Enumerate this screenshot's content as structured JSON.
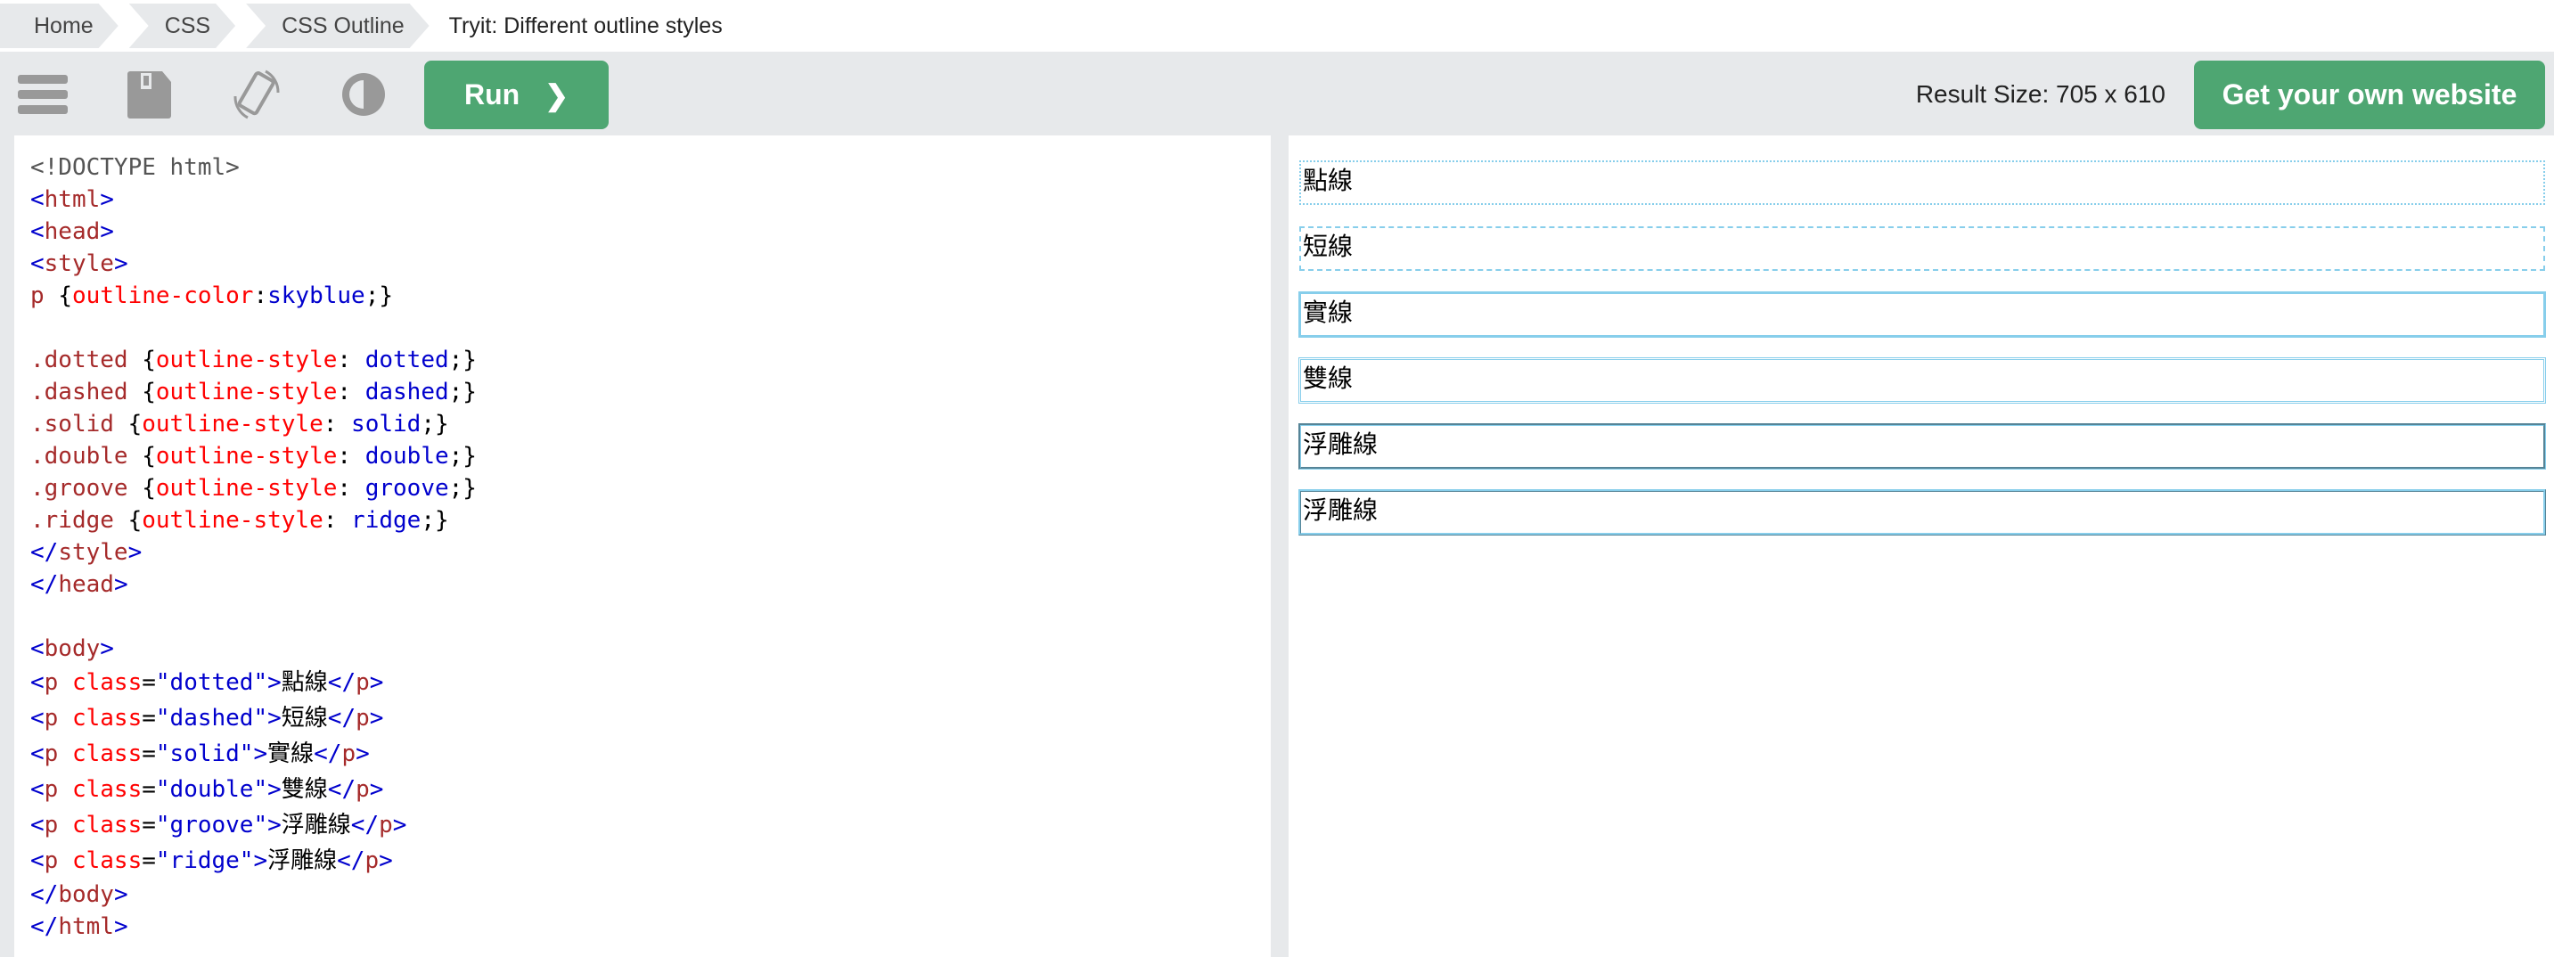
{
  "breadcrumb": [
    "Home",
    "CSS",
    "CSS Outline",
    "Tryit: Different outline styles"
  ],
  "toolbar": {
    "menu_icon": "hamburger-icon",
    "save_icon": "floppy-icon",
    "rotate_icon": "rotate-icon",
    "contrast_icon": "contrast-icon",
    "run_label": "Run",
    "run_chevron": "❯",
    "result_size": "Result Size: 705 x 610",
    "own_website": "Get your own website",
    "accent": "#4ea672"
  },
  "code": [
    [
      [
        "<!DOCTYPE html>",
        "doc"
      ]
    ],
    [
      [
        "<",
        "br"
      ],
      [
        "html",
        "tag"
      ],
      [
        ">",
        "br"
      ]
    ],
    [
      [
        "<",
        "br"
      ],
      [
        "head",
        "tag"
      ],
      [
        ">",
        "br"
      ]
    ],
    [
      [
        "<",
        "br"
      ],
      [
        "style",
        "tag"
      ],
      [
        ">",
        "br"
      ]
    ],
    [
      [
        "p ",
        "sel"
      ],
      [
        "{",
        "txt"
      ],
      [
        "outline-color",
        "prop"
      ],
      [
        ":",
        "txt"
      ],
      [
        "skyblue",
        "val"
      ],
      [
        ";}",
        "txt"
      ]
    ],
    [],
    [
      [
        ".dotted ",
        "sel"
      ],
      [
        "{",
        "txt"
      ],
      [
        "outline-style",
        "prop"
      ],
      [
        ": ",
        "txt"
      ],
      [
        "dotted",
        "val"
      ],
      [
        ";}",
        "txt"
      ]
    ],
    [
      [
        ".dashed ",
        "sel"
      ],
      [
        "{",
        "txt"
      ],
      [
        "outline-style",
        "prop"
      ],
      [
        ": ",
        "txt"
      ],
      [
        "dashed",
        "val"
      ],
      [
        ";}",
        "txt"
      ]
    ],
    [
      [
        ".solid ",
        "sel"
      ],
      [
        "{",
        "txt"
      ],
      [
        "outline-style",
        "prop"
      ],
      [
        ": ",
        "txt"
      ],
      [
        "solid",
        "val"
      ],
      [
        ";}",
        "txt"
      ]
    ],
    [
      [
        ".double ",
        "sel"
      ],
      [
        "{",
        "txt"
      ],
      [
        "outline-style",
        "prop"
      ],
      [
        ": ",
        "txt"
      ],
      [
        "double",
        "val"
      ],
      [
        ";}",
        "txt"
      ]
    ],
    [
      [
        ".groove ",
        "sel"
      ],
      [
        "{",
        "txt"
      ],
      [
        "outline-style",
        "prop"
      ],
      [
        ": ",
        "txt"
      ],
      [
        "groove",
        "val"
      ],
      [
        ";}",
        "txt"
      ]
    ],
    [
      [
        ".ridge ",
        "sel"
      ],
      [
        "{",
        "txt"
      ],
      [
        "outline-style",
        "prop"
      ],
      [
        ": ",
        "txt"
      ],
      [
        "ridge",
        "val"
      ],
      [
        ";}",
        "txt"
      ]
    ],
    [
      [
        "</",
        "br"
      ],
      [
        "style",
        "tag"
      ],
      [
        ">",
        "br"
      ]
    ],
    [
      [
        "</",
        "br"
      ],
      [
        "head",
        "tag"
      ],
      [
        ">",
        "br"
      ]
    ],
    [],
    [
      [
        "<",
        "br"
      ],
      [
        "body",
        "tag"
      ],
      [
        ">",
        "br"
      ]
    ],
    [
      [
        "<",
        "br"
      ],
      [
        "p",
        "tag"
      ],
      [
        " class",
        "attr"
      ],
      [
        "=",
        "txt"
      ],
      [
        "\"dotted\"",
        "val"
      ],
      [
        ">",
        "br"
      ],
      [
        "點線",
        "txt"
      ],
      [
        "</",
        "br"
      ],
      [
        "p",
        "tag"
      ],
      [
        ">",
        "br"
      ]
    ],
    [
      [
        "<",
        "br"
      ],
      [
        "p",
        "tag"
      ],
      [
        " class",
        "attr"
      ],
      [
        "=",
        "txt"
      ],
      [
        "\"dashed\"",
        "val"
      ],
      [
        ">",
        "br"
      ],
      [
        "短線",
        "txt"
      ],
      [
        "</",
        "br"
      ],
      [
        "p",
        "tag"
      ],
      [
        ">",
        "br"
      ]
    ],
    [
      [
        "<",
        "br"
      ],
      [
        "p",
        "tag"
      ],
      [
        " class",
        "attr"
      ],
      [
        "=",
        "txt"
      ],
      [
        "\"solid\"",
        "val"
      ],
      [
        ">",
        "br"
      ],
      [
        "實線",
        "txt"
      ],
      [
        "</",
        "br"
      ],
      [
        "p",
        "tag"
      ],
      [
        ">",
        "br"
      ]
    ],
    [
      [
        "<",
        "br"
      ],
      [
        "p",
        "tag"
      ],
      [
        " class",
        "attr"
      ],
      [
        "=",
        "txt"
      ],
      [
        "\"double\"",
        "val"
      ],
      [
        ">",
        "br"
      ],
      [
        "雙線",
        "txt"
      ],
      [
        "</",
        "br"
      ],
      [
        "p",
        "tag"
      ],
      [
        ">",
        "br"
      ]
    ],
    [
      [
        "<",
        "br"
      ],
      [
        "p",
        "tag"
      ],
      [
        " class",
        "attr"
      ],
      [
        "=",
        "txt"
      ],
      [
        "\"groove\"",
        "val"
      ],
      [
        ">",
        "br"
      ],
      [
        "浮雕線",
        "txt"
      ],
      [
        "</",
        "br"
      ],
      [
        "p",
        "tag"
      ],
      [
        ">",
        "br"
      ]
    ],
    [
      [
        "<",
        "br"
      ],
      [
        "p",
        "tag"
      ],
      [
        " class",
        "attr"
      ],
      [
        "=",
        "txt"
      ],
      [
        "\"ridge\"",
        "val"
      ],
      [
        ">",
        "br"
      ],
      [
        "浮雕線",
        "txt"
      ],
      [
        "</",
        "br"
      ],
      [
        "p",
        "tag"
      ],
      [
        ">",
        "br"
      ]
    ],
    [
      [
        "</",
        "br"
      ],
      [
        "body",
        "tag"
      ],
      [
        ">",
        "br"
      ]
    ],
    [
      [
        "</",
        "br"
      ],
      [
        "html",
        "tag"
      ],
      [
        ">",
        "br"
      ]
    ]
  ],
  "result": {
    "outline_color": "#87ceeb",
    "items": [
      {
        "text": "點線",
        "style": "dotted"
      },
      {
        "text": "短線",
        "style": "dashed"
      },
      {
        "text": "實線",
        "style": "solid"
      },
      {
        "text": "雙線",
        "style": "double"
      },
      {
        "text": "浮雕線",
        "style": "groove"
      },
      {
        "text": "浮雕線",
        "style": "ridge"
      }
    ]
  }
}
